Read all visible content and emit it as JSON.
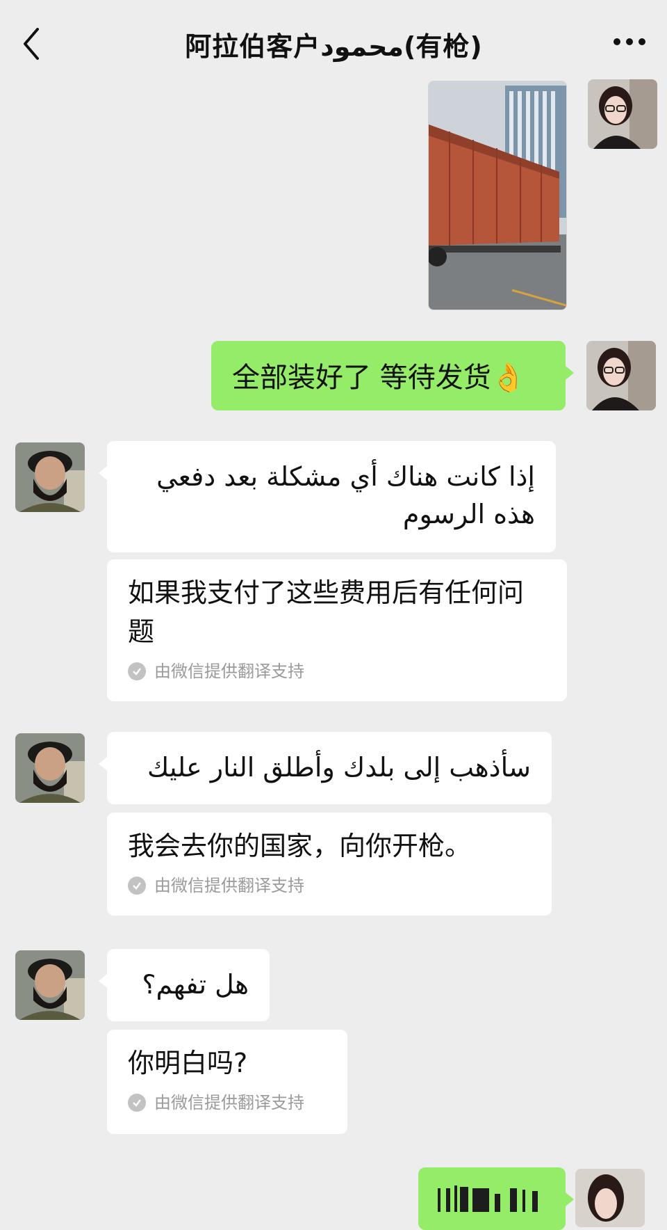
{
  "header": {
    "title": "阿拉伯客户محمود(有枪)"
  },
  "messages": {
    "m2": {
      "text": "全部装好了 等待发货👌"
    },
    "m3": {
      "original": "إذا كانت هناك أي مشكلة بعد دفعي هذه الرسوم",
      "translation": "如果我支付了这些费用后有任何问题",
      "note": "由微信提供翻译支持"
    },
    "m4": {
      "original": "سأذهب إلى بلدك وأطلق النار عليك",
      "translation": "我会去你的国家，向你开枪。",
      "note": "由微信提供翻译支持"
    },
    "m5": {
      "original": "هل تفهم؟",
      "translation": "你明白吗?",
      "note": "由微信提供翻译支持"
    }
  },
  "colors": {
    "background": "#ededed",
    "my_bubble": "#95ec69",
    "their_bubble": "#ffffff"
  },
  "icons": [
    "back-arrow-icon",
    "more-dots-icon",
    "translation-check-icon"
  ]
}
